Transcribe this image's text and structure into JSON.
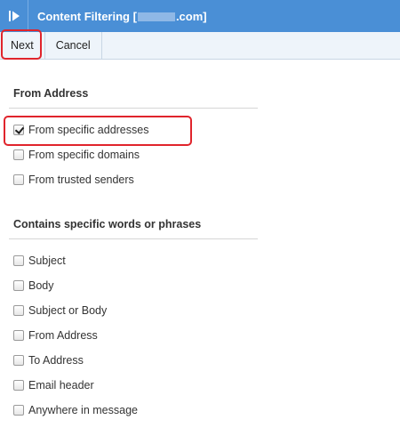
{
  "window": {
    "title_prefix": "Content Filtering [",
    "title_suffix": ".com]",
    "back_icon": "collapse-left-icon"
  },
  "toolbar": {
    "next_label": "Next",
    "cancel_label": "Cancel"
  },
  "from_address": {
    "heading": "From Address",
    "options": [
      {
        "label": "From specific addresses",
        "checked": true
      },
      {
        "label": "From specific domains",
        "checked": false
      },
      {
        "label": "From trusted senders",
        "checked": false
      }
    ]
  },
  "contains_words": {
    "heading": "Contains specific words or phrases",
    "options": [
      {
        "label": "Subject",
        "checked": false
      },
      {
        "label": "Body",
        "checked": false
      },
      {
        "label": "Subject or Body",
        "checked": false
      },
      {
        "label": "From Address",
        "checked": false
      },
      {
        "label": "To Address",
        "checked": false
      },
      {
        "label": "Email header",
        "checked": false
      },
      {
        "label": "Anywhere in message",
        "checked": false
      }
    ]
  },
  "colors": {
    "titlebar": "#4a8fd6",
    "highlight": "#e0242c"
  }
}
